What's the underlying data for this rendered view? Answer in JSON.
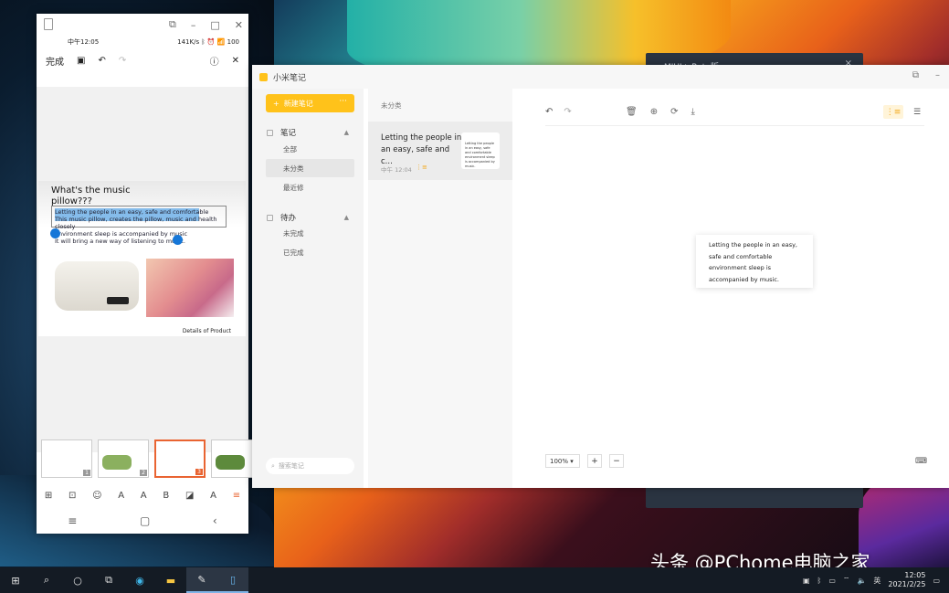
{
  "background_window": {
    "title": "MIUI+ Beta版",
    "close": "×"
  },
  "phone": {
    "status": {
      "time": "中午12:05",
      "right": "141K/s ᛒ ⏰ 📶 100"
    },
    "toolbar": {
      "done": "完成",
      "save_icon": "save-icon",
      "undo": "↶",
      "redo": "↷"
    },
    "slide": {
      "title": "What's the music pillow???",
      "text1": "Letting the people in an easy, safe and comfortable",
      "text2": "This music pillow, creates the pillow, music and health closely",
      "text3": "environment sleep is accompanied by music",
      "text4": "It will bring a new way of listening to music.",
      "caption": "Details of Product"
    },
    "thumbnails": [
      {
        "n": "1"
      },
      {
        "n": "2"
      },
      {
        "n": "3"
      },
      {
        "n": ""
      }
    ]
  },
  "notes_app": {
    "title": "小米笔记",
    "new_button": "新建笔记",
    "more": "···",
    "groups": {
      "notes": {
        "label": "笔记",
        "items": [
          "全部",
          "未分类",
          "最近修"
        ]
      },
      "todo": {
        "label": "待办",
        "items": [
          "未完成",
          "已完成"
        ]
      }
    },
    "search_placeholder": "搜索笔记",
    "list_header": "未分类",
    "card": {
      "text": "Letting the people in an easy, safe and c...",
      "time": "中午 12:04"
    },
    "editor": {
      "content": "Letting the people in an easy, safe and comfortable environment sleep is accompanied by music.",
      "zoom": "100%",
      "plus": "+",
      "minus": "−"
    }
  },
  "taskbar": {
    "ime": "英",
    "time": "12:05",
    "date": "2021/2/25"
  },
  "watermark": "头条 @PChome电脑之家",
  "colors": {
    "accent": "#ffc21a",
    "selection": "#e96432",
    "handle": "#1677d8"
  }
}
